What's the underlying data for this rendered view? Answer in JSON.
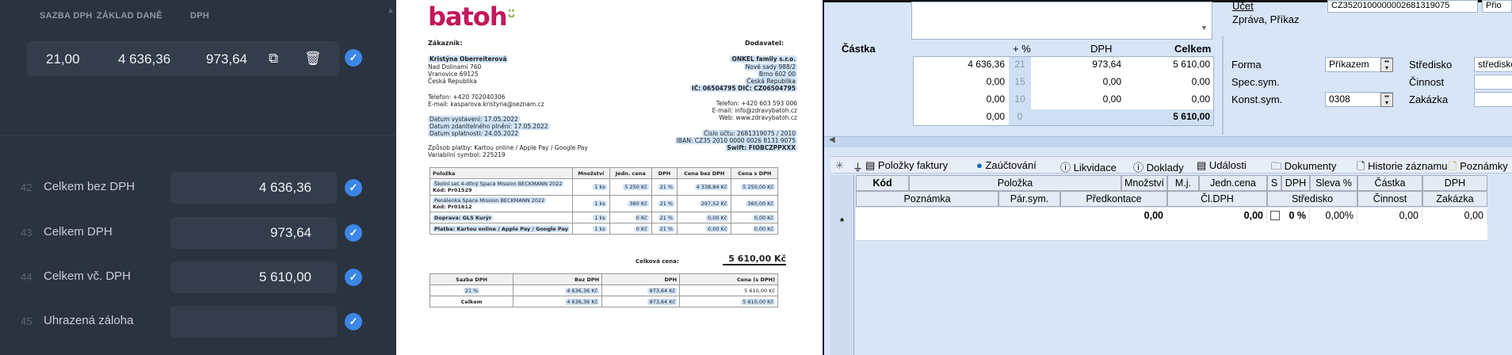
{
  "left_panel": {
    "headers": {
      "rate": "SAZBA DPH",
      "base": "ZÁKLAD DANĚ",
      "vat": "DPH"
    },
    "vat_row": {
      "rate": "21,00",
      "base": "4 636,36",
      "vat": "973,64"
    },
    "summary": [
      {
        "num": "42",
        "label": "Celkem bez DPH",
        "value": "4 636,36"
      },
      {
        "num": "43",
        "label": "Celkem DPH",
        "value": "973,64"
      },
      {
        "num": "44",
        "label": "Celkem vč. DPH",
        "value": "5 610,00"
      },
      {
        "num": "45",
        "label": "Uhrazená záloha",
        "value": ""
      }
    ]
  },
  "invoice": {
    "logo": "batoh",
    "customer_label": "Zákazník:",
    "supplier_label": "Dodavatel:",
    "customer": [
      "Kristýna Oberreiterová",
      "Nad Dolinami 760",
      "Vranovice 69125",
      "Česká Republika"
    ],
    "supplier": [
      "ONKEL family s.r.o.",
      "Nové sady 988/2",
      "Brno 602 00",
      "Česká Republika"
    ],
    "supplier_ids": "IČ: 06504795 DIČ: CZ06504795",
    "customer_phone": "Telefon: +420 702040306",
    "customer_email": "E-mail: kasparova.kristyna@seznam.cz",
    "supplier_phone": "Telefon: +420 603 593 006",
    "supplier_email": "E-mail: info@zdravybatoh.cz",
    "supplier_web": "Web: www.zdravybatoh.cz",
    "date_issued": "Datum vystavení: 17.05.2022",
    "date_taxable": "Datum zdanitelného plnění: 17.05.2022",
    "date_due": "Datum splatnosti: 24.05.2022",
    "account": "Číslo účtu: 2681319075 / 2010",
    "iban": "IBAN: CZ35 2010 0000 0026 8131 9075",
    "swift": "Swift: FIOBCZPPXXX",
    "payment": "Způsob platby: Kartou online / Apple Pay / Google Pay",
    "vs": "Variabilní symbol: 225219",
    "items_headers": [
      "Položka",
      "Množství",
      "Jedn. cena",
      "DPH",
      "Cena bez DPH",
      "Cena s DPH"
    ],
    "items": [
      {
        "name": "Školní set 4-dílný Space Mission BECKMANN 2022",
        "code": "Kód: Pr01529",
        "qty": "1 ks",
        "unit": "5 250 Kč",
        "vat": "21 %",
        "net": "4 338,84 Kč",
        "gross": "5 250,00 Kč"
      },
      {
        "name": "Penálenka Space Mission BECKMANN 2022",
        "code": "Kód: Pr01612",
        "qty": "1 ks",
        "unit": "360 Kč",
        "vat": "21 %",
        "net": "297,52 Kč",
        "gross": "360,00 Kč"
      },
      {
        "name": "Doprava: GLS Kurýr",
        "code": "",
        "qty": "1 ks",
        "unit": "0 Kč",
        "vat": "21 %",
        "net": "0,00 Kč",
        "gross": "0,00 Kč"
      },
      {
        "name": "Platba: Kartou online / Apple Pay / Google Pay",
        "code": "",
        "qty": "1 ks",
        "unit": "0 Kč",
        "vat": "21 %",
        "net": "0,00 Kč",
        "gross": "0,00 Kč"
      }
    ],
    "total_label": "Celková cena:",
    "total": "5 610,00 Kč",
    "vat_headers": [
      "Sazba DPH",
      "Bez DPH",
      "DPH",
      "Cena (s DPH)"
    ],
    "vat_rows": [
      [
        "21 %",
        "4 636,36 Kč",
        "973,64 Kč",
        "5 610,00 Kč"
      ],
      [
        "Celkem",
        "4 636,36 Kč",
        "973,64 Kč",
        "5 610,00 Kč"
      ]
    ]
  },
  "app": {
    "ucet_label": "Účet",
    "ucet_value": "CZ3520100000002681319075",
    "zprava_label": "Zpráva, Příkaz",
    "prio_value": "Přio",
    "castka_label": "Částka",
    "pct_label": "+ %",
    "dph_label": "DPH",
    "celkem_label": "Celkem",
    "rows": [
      {
        "base": "4 636,36",
        "rate": "21",
        "vat": "973,64",
        "total": "5 610,00"
      },
      {
        "base": "0,00",
        "rate": "15",
        "vat": "0,00",
        "total": "0,00"
      },
      {
        "base": "0,00",
        "rate": "10",
        "vat": "0,00",
        "total": "0,00"
      },
      {
        "base": "0,00",
        "rate": "0",
        "vat": "",
        "total": "5 610,00"
      }
    ],
    "forma_label": "Forma",
    "forma_value": "Příkazem",
    "spec_label": "Spec.sym.",
    "konst_label": "Konst.sym.",
    "konst_value": "0308",
    "stredisko_label": "Středisko",
    "stredisko_value": "středisko",
    "cinnost_label": "Činnost",
    "zakazka_label": "Zakázka",
    "tabs": [
      "Položky faktury",
      "Zaúčtování",
      "Likvidace",
      "Doklady",
      "Události",
      "Dokumenty",
      "Historie záznamu",
      "Poznámky"
    ],
    "grid_headers1": [
      "Kód",
      "Položka",
      "Množství",
      "M.j.",
      "Jedn.cena",
      "S",
      "DPH",
      "Sleva %",
      "Částka",
      "DPH"
    ],
    "grid_headers2": [
      "Poznámka",
      "Pár.sym.",
      "Předkontace",
      "Čl.DPH",
      "Středisko",
      "Činnost",
      "Zakázka"
    ],
    "new_row": {
      "qty": "0,00",
      "unit": "0,00",
      "dph": "0 %",
      "sleva": "0,00%",
      "castka": "0,00",
      "dph2": "0,00"
    }
  }
}
